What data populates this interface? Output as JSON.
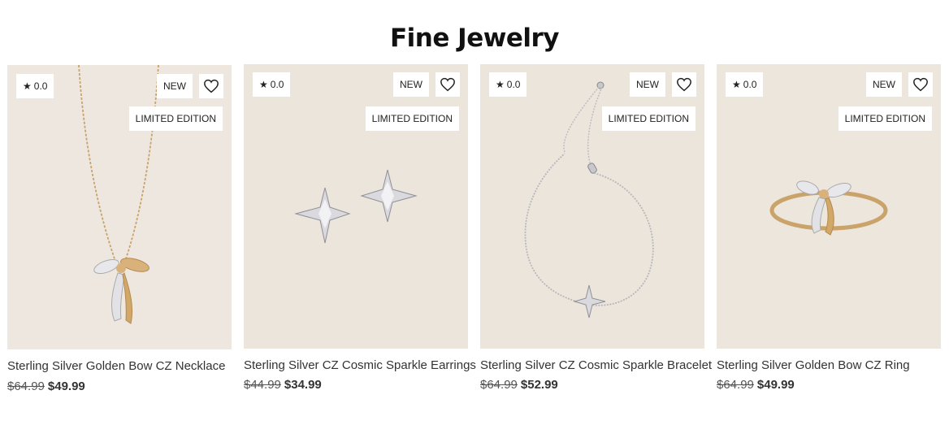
{
  "section": {
    "title": "Fine Jewelry"
  },
  "products": [
    {
      "name": "Sterling Silver Golden Bow CZ Necklace",
      "rating": "0.0",
      "badge_new": "NEW",
      "badge_edition": "LIMITED EDITION",
      "was_price": "$64.99",
      "price": "$49.99",
      "image": "gold-bow-necklace"
    },
    {
      "name": "Sterling Silver CZ Cosmic Sparkle Earrings",
      "rating": "0.0",
      "badge_new": "NEW",
      "badge_edition": "LIMITED EDITION",
      "was_price": "$44.99",
      "price": "$34.99",
      "image": "star-stud-earrings"
    },
    {
      "name": "Sterling Silver CZ Cosmic Sparkle Bracelet",
      "rating": "0.0",
      "badge_new": "NEW",
      "badge_edition": "LIMITED EDITION",
      "was_price": "$64.99",
      "price": "$52.99",
      "image": "star-slider-bracelet"
    },
    {
      "name": "Sterling Silver Golden Bow CZ Ring",
      "rating": "0.0",
      "badge_new": "NEW",
      "badge_edition": "LIMITED EDITION",
      "was_price": "$64.99",
      "price": "$49.99",
      "image": "gold-bow-ring"
    }
  ],
  "colors": {
    "image_background": "#ebe6dd",
    "gold": "#c9a36a",
    "silver": "#c8c8cc"
  }
}
